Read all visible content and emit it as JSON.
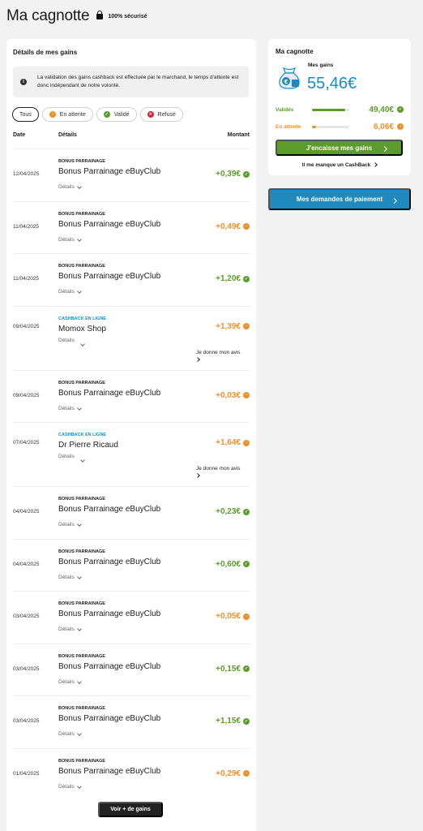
{
  "header": {
    "title": "Ma cagnotte",
    "secure_label": "100% sécurisé"
  },
  "gains": {
    "title": "Détails de mes gains",
    "info": "La validation des gains cashback est effectuée par le marchand, le temps d'attente est donc indépendant de notre volonté.",
    "filters": [
      {
        "label": "Tous",
        "status": "all",
        "active": true
      },
      {
        "label": "En attente",
        "status": "pending"
      },
      {
        "label": "Validé",
        "status": "validated"
      },
      {
        "label": "Refusé",
        "status": "refused"
      }
    ],
    "columns": {
      "date": "Date",
      "details": "Détails",
      "amount": "Montant"
    },
    "details_label": "Détails",
    "review_label": "Je donne mon avis",
    "more_button": "Voir + de gains",
    "rows": [
      {
        "date": "12/04/2025",
        "category": "BONUS PARRAINAGE",
        "merchant": "Bonus Parrainage eBuyClub",
        "amount": "+0,39€",
        "status": "validated"
      },
      {
        "date": "11/04/2025",
        "category": "BONUS PARRAINAGE",
        "merchant": "Bonus Parrainage eBuyClub",
        "amount": "+0,49€",
        "status": "pending"
      },
      {
        "date": "11/04/2025",
        "category": "BONUS PARRAINAGE",
        "merchant": "Bonus Parrainage eBuyClub",
        "amount": "+1,20€",
        "status": "validated"
      },
      {
        "date": "09/04/2025",
        "category": "CASHBACK EN LIGNE",
        "merchant": "Momox Shop",
        "amount": "+1,39€",
        "status": "pending",
        "review": true
      },
      {
        "date": "09/04/2025",
        "category": "BONUS PARRAINAGE",
        "merchant": "Bonus Parrainage eBuyClub",
        "amount": "+0,03€",
        "status": "pending"
      },
      {
        "date": "07/04/2025",
        "category": "CASHBACK EN LIGNE",
        "merchant": "Dr Pierre Ricaud",
        "amount": "+1,64€",
        "status": "pending",
        "review": true
      },
      {
        "date": "04/04/2025",
        "category": "BONUS PARRAINAGE",
        "merchant": "Bonus Parrainage eBuyClub",
        "amount": "+0,23€",
        "status": "validated"
      },
      {
        "date": "04/04/2025",
        "category": "BONUS PARRAINAGE",
        "merchant": "Bonus Parrainage eBuyClub",
        "amount": "+0,60€",
        "status": "validated"
      },
      {
        "date": "03/04/2025",
        "category": "BONUS PARRAINAGE",
        "merchant": "Bonus Parrainage eBuyClub",
        "amount": "+0,05€",
        "status": "pending"
      },
      {
        "date": "03/04/2025",
        "category": "BONUS PARRAINAGE",
        "merchant": "Bonus Parrainage eBuyClub",
        "amount": "+0,15€",
        "status": "validated"
      },
      {
        "date": "03/04/2025",
        "category": "BONUS PARRAINAGE",
        "merchant": "Bonus Parrainage eBuyClub",
        "amount": "+1,15€",
        "status": "validated"
      },
      {
        "date": "01/04/2025",
        "category": "BONUS PARRAINAGE",
        "merchant": "Bonus Parrainage eBuyClub",
        "amount": "+0,29€",
        "status": "pending"
      }
    ]
  },
  "cagnotte": {
    "title": "Ma cagnotte",
    "gains_label": "Mes gains",
    "total": "55,46€",
    "validated": {
      "label": "Validés",
      "amount": "49,40€",
      "fraction": 0.89
    },
    "pending": {
      "label": "En attente",
      "amount": "6,06€",
      "fraction": 0.11
    },
    "cash_button": "J'encaisse mes gains",
    "missing_link": "Il me manque un CashBack"
  },
  "payment_button": "Mes demandes de paiement",
  "colors": {
    "green": "#5c9c2d",
    "orange": "#f0902b",
    "red": "#d4263b",
    "blue": "#1f8ac0",
    "dark": "#222222"
  },
  "icons": {
    "secure": "lock-icon",
    "info": "info-icon",
    "bag": "money-bag-icon",
    "pending": "clock-icon",
    "validated": "check-icon",
    "refused": "cross-icon"
  }
}
